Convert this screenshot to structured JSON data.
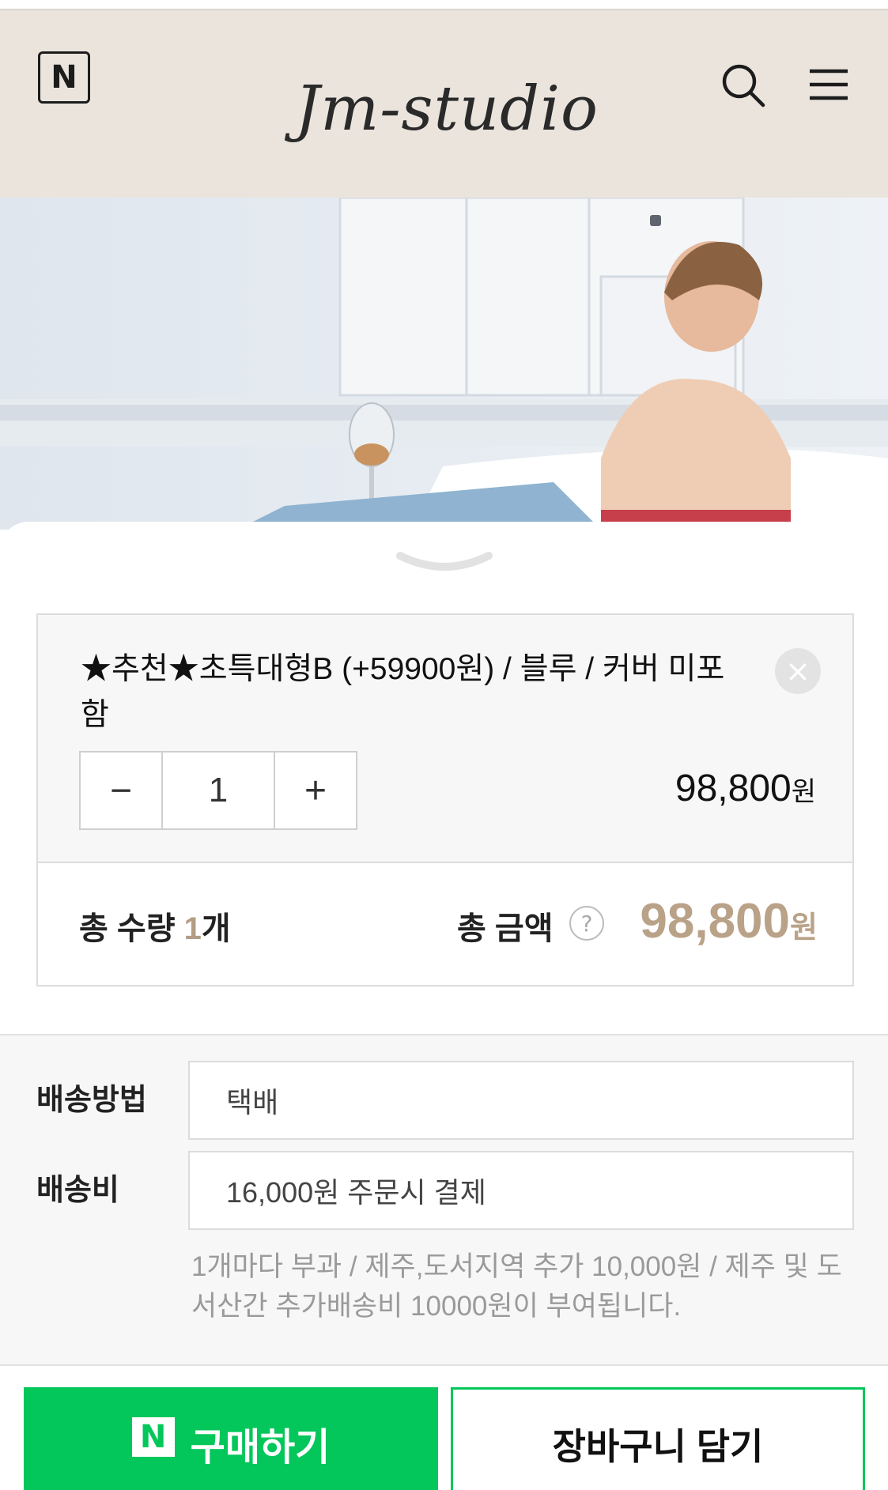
{
  "header": {
    "naver_badge": "N",
    "brand_logo": "Jm-studio",
    "icons": [
      "search-icon",
      "menu-icon"
    ]
  },
  "option": {
    "title": "★추천★초특대형B (+59900원) / 블루 / 커버 미포함",
    "quantity": "1",
    "minus": "−",
    "plus": "+",
    "price": "98,800",
    "unit": "원"
  },
  "summary": {
    "qty_prefix": "총 수량 ",
    "qty_value": "1",
    "qty_suffix": "개",
    "total_label": "총 금액",
    "total_price": "98,800",
    "unit": "원"
  },
  "shipping": {
    "method_label": "배송방법",
    "method_value": "택배",
    "fee_label": "배송비",
    "fee_value": "16,000원 주문시 결제",
    "note": "1개마다 부과 / 제주,도서지역 추가 10,000원 / 제주 및 도서산간 추가배송비 10000원이 부여됩니다."
  },
  "actions": {
    "npay_badge": "N",
    "buy_label": "구매하기",
    "cart_label": "장바구니 담기"
  },
  "colors": {
    "header_bg": "#ebe4dd",
    "accent_price": "#b9a288",
    "naver_green": "#03c75a"
  }
}
